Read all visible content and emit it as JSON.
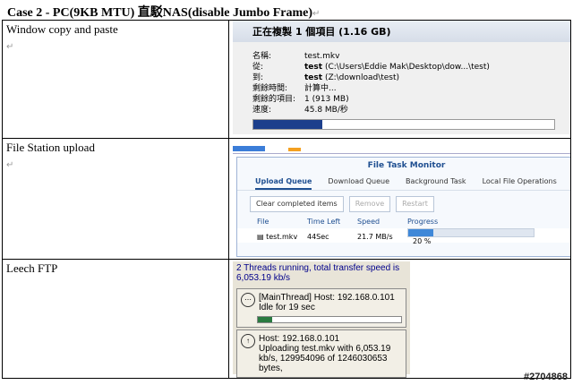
{
  "title": "Case 2 - PC(9KB MTU)  直駁NAS(disable Jumbo Frame)",
  "rows": [
    {
      "label": "Window copy and paste"
    },
    {
      "label": "File Station upload"
    },
    {
      "label": "Leech FTP"
    }
  ],
  "copy": {
    "header": "正在複製 1 個項目 (1.16 GB)",
    "fields": [
      {
        "k": "名稱:",
        "v": "test.mkv",
        "bold": ""
      },
      {
        "k": "從:",
        "v": " (C:\\Users\\Eddie Mak\\Desktop\\dow...\\test)",
        "bold": "test"
      },
      {
        "k": "到:",
        "v": " (Z:\\download\\test)",
        "bold": "test"
      },
      {
        "k": "剩餘時間:",
        "v": "計算中...",
        "bold": ""
      },
      {
        "k": "剩餘的項目:",
        "v": "1 (913 MB)",
        "bold": ""
      },
      {
        "k": "速度:",
        "v": "45.8 MB/秒",
        "bold": ""
      }
    ],
    "progress": 0.23
  },
  "filestation": {
    "window_title": "File Task Monitor",
    "tabs": [
      "Upload Queue",
      "Download Queue",
      "Background Task",
      "Local File Operations"
    ],
    "buttons": [
      "Clear completed items",
      "Remove",
      "Restart"
    ],
    "columns": [
      "File",
      "Time Left",
      "Speed",
      "Progress"
    ],
    "row": {
      "file": "test.mkv",
      "time_left": "44Sec",
      "speed": "21.7 MB/s",
      "progress_pct": "20 %"
    },
    "progress": 0.2
  },
  "ftp": {
    "header": "2 Threads running, total transfer speed is 6,053.19 kb/s",
    "thread1_line1": "[MainThread] Host: 192.168.0.101",
    "thread1_line2": "Idle for 19 sec",
    "thread2_line1": "Host: 192.168.0.101",
    "thread2_line2": "Uploading test.mkv with 6,053.19 kb/s, 129954096 of 1246030653 bytes,",
    "progress": 0.1
  },
  "watermark": "#2704868"
}
